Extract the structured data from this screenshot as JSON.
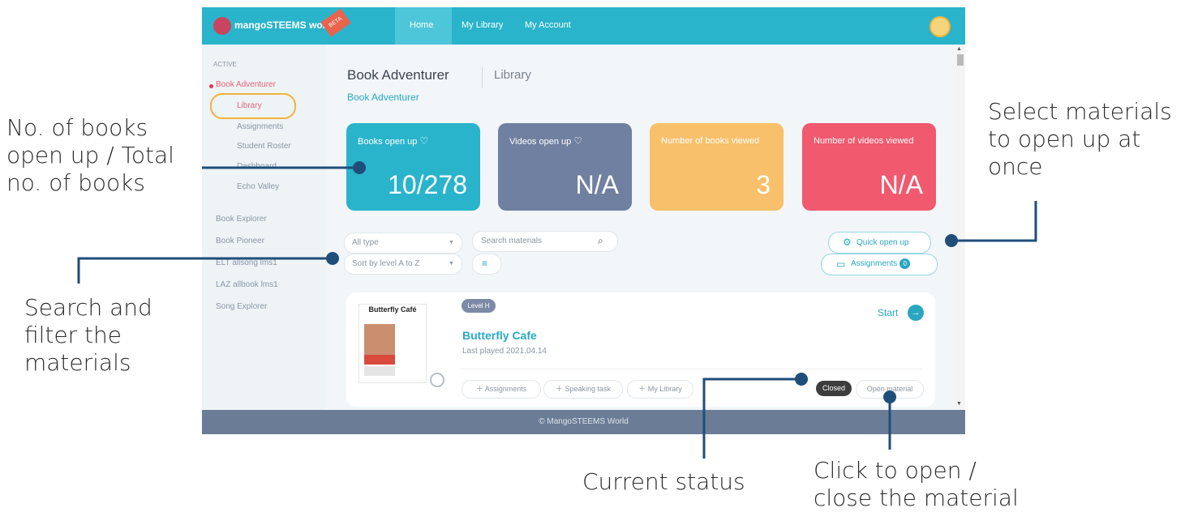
{
  "app": {
    "logo_text": "mangoSTEEMS world",
    "beta_label": "BETA",
    "nav": [
      {
        "label": "Home"
      },
      {
        "label": "My Library"
      },
      {
        "label": "My Account"
      }
    ]
  },
  "sidebar": {
    "section_label": "ACTIVE",
    "active_course": "Book Adventurer",
    "sub_items": [
      "Library",
      "Assignments",
      "Student Roster",
      "Dashboard",
      "Echo Valley"
    ],
    "courses": [
      "Book Explorer",
      "Book Pioneer",
      "ELT allsong lms1",
      "LAZ allbook lms1",
      "Song Explorer"
    ]
  },
  "header": {
    "title": "Book Adventurer",
    "subtitle": "Library",
    "breadcrumb": "Book Adventurer"
  },
  "stats": [
    {
      "label": "Books open up",
      "value": "10/278",
      "color": "#2ab4cb"
    },
    {
      "label": "Videos open up",
      "value": "N/A",
      "color": "#7080a0"
    },
    {
      "label": "Number of books viewed",
      "value": "3",
      "color": "#f8c06a"
    },
    {
      "label": "Number of videos viewed",
      "value": "N/A",
      "color": "#f0596e"
    }
  ],
  "filters": {
    "type": "All type",
    "sort": "Sort by level A to Z",
    "search_placeholder": "Search materials"
  },
  "actions": {
    "quick_open": "Quick open up",
    "assignments": "Assignments",
    "assignments_count": "0"
  },
  "book": {
    "level": "Level H",
    "title": "Butterfly Cafe",
    "cover_title": "Butterfly Café",
    "last_played": "Last played 2021.04.14",
    "start_label": "Start",
    "chips": [
      "Assignments",
      "Speaking task",
      "My Library"
    ],
    "status": "Closed",
    "open_button": "Open material"
  },
  "footer": "© MangoSTEEMS World",
  "annotations": {
    "books_count": "No. of books\nopen up / Total\nno. of books",
    "search_filter": "Search and\nfilter the\nmaterials",
    "select_materials": "Select materials\nto open up at\nonce",
    "current_status": "Current status",
    "click_open": "Click to open /\nclose the material"
  }
}
